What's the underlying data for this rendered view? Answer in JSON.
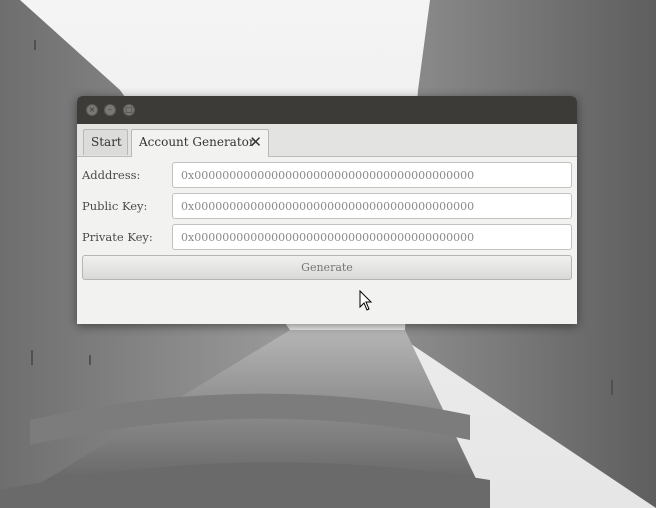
{
  "window": {
    "buttons": {
      "close": "×",
      "minimize": "–",
      "maximize": "□"
    }
  },
  "tabs": [
    {
      "label": "Start"
    },
    {
      "label": "Account Generator",
      "close_glyph": "✕"
    }
  ],
  "form": {
    "address_label": "Adddress:",
    "address_placeholder": "0x0000000000000000000000000000000000000000",
    "public_key_label": "Public Key:",
    "public_key_placeholder": "0x0000000000000000000000000000000000000000",
    "private_key_label": "Private Key:",
    "private_key_placeholder": "0x0000000000000000000000000000000000000000",
    "generate_label": "Generate"
  }
}
